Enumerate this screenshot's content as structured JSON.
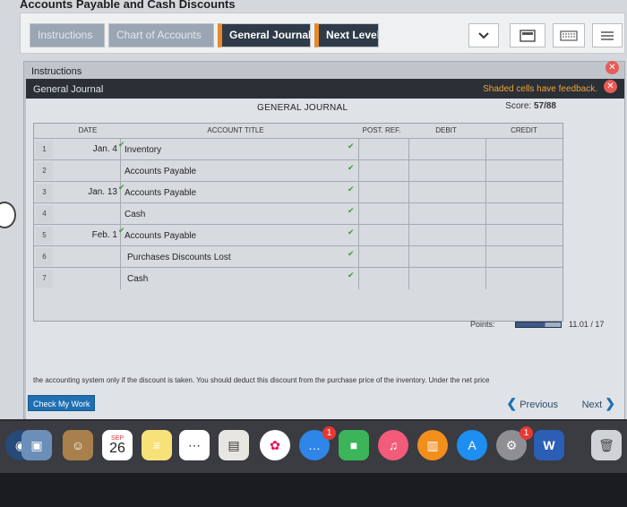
{
  "app_title": "Accounts Payable and Cash Discounts",
  "toolbar": {
    "tabs": [
      {
        "label": "Instructions",
        "state": "inactive"
      },
      {
        "label": "Chart of Accounts",
        "state": "inactive"
      },
      {
        "label": "General Journal",
        "state": "active"
      },
      {
        "label": "Next Level",
        "state": "active"
      }
    ],
    "tool_icons": [
      "chevron-down-icon",
      "calculator-icon",
      "keyboard-icon",
      "list-icon"
    ]
  },
  "panel": {
    "title": "Instructions",
    "bar_title": "General Journal",
    "feedback": "Shaded cells have feedback.",
    "score_label": "Score:",
    "score_value": "57/88",
    "journal_title": "GENERAL JOURNAL"
  },
  "journal": {
    "columns": [
      "DATE",
      "ACCOUNT TITLE",
      "POST. REF.",
      "DEBIT",
      "CREDIT"
    ],
    "rows": [
      {
        "num": "1",
        "date": "Jan. 4",
        "account": "Inventory",
        "indent": 0
      },
      {
        "num": "2",
        "date": "",
        "account": "Accounts Payable",
        "indent": 0
      },
      {
        "num": "3",
        "date": "Jan. 13",
        "account": "Accounts Payable",
        "indent": 0
      },
      {
        "num": "4",
        "date": "",
        "account": "Cash",
        "indent": 0
      },
      {
        "num": "5",
        "date": "Feb. 1",
        "account": "Accounts Payable",
        "indent": 0
      },
      {
        "num": "6",
        "date": "",
        "account": "Purchases Discounts Lost",
        "indent": 1
      },
      {
        "num": "7",
        "date": "",
        "account": "Cash",
        "indent": 1
      }
    ]
  },
  "points": {
    "label": "Points:",
    "value": "11.01 / 17",
    "fraction": 0.65
  },
  "hint": "the accounting system only if the discount is taken. You should deduct this discount from the purchase price of the inventory. Under the net price",
  "check_work": "Check My Work",
  "nav": {
    "previous": "Previous",
    "next": "Next"
  },
  "dock": {
    "calendar_month": "SEP",
    "calendar_day": "26",
    "messages_badge": "1",
    "settings_badge": "1",
    "word_letter": "W"
  },
  "colors": {
    "accent": "#1f6fb2",
    "tab_active": "#2f3b48",
    "tab_marker": "#e6892c",
    "feedback": "#f0a43c",
    "check": "#3c9a3c"
  }
}
